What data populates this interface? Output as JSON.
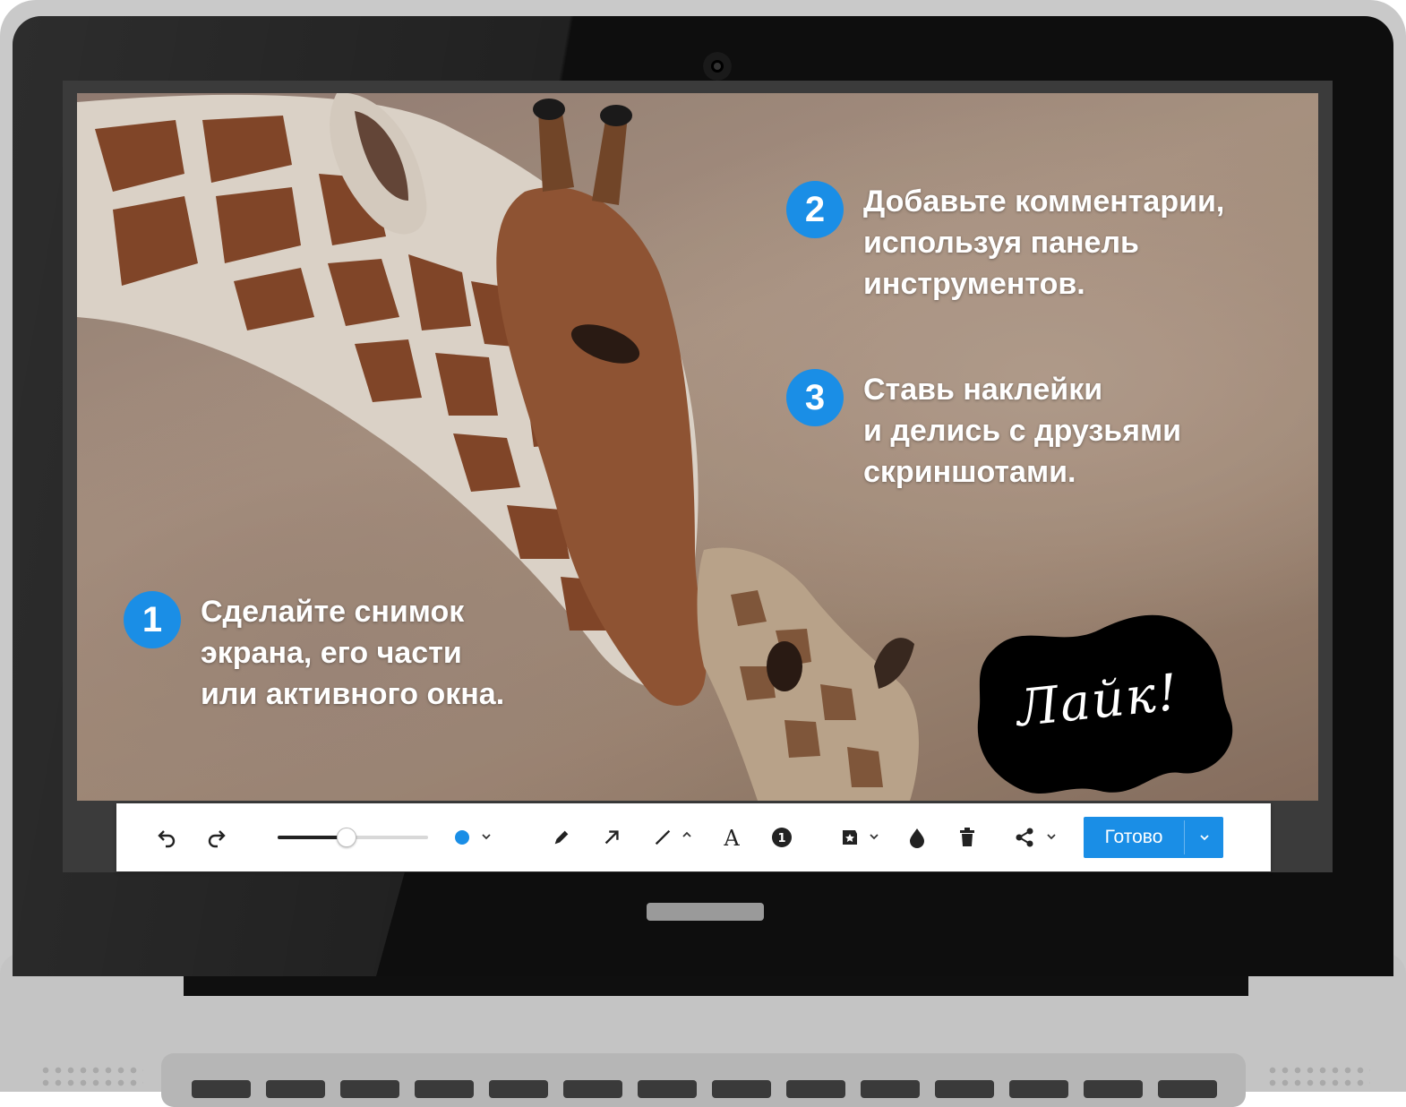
{
  "steps": [
    {
      "number": "1",
      "lines": [
        "Сделайте снимок",
        "экрана, его части",
        "или активного окна."
      ]
    },
    {
      "number": "2",
      "lines": [
        "Добавьте комментарии,",
        "используя панель",
        "инструментов."
      ]
    },
    {
      "number": "3",
      "lines": [
        "Ставь наклейки",
        "и делись с друзьями",
        "скриншотами."
      ]
    }
  ],
  "sticker": {
    "label": "Лайк!"
  },
  "toolbar": {
    "done_label": "Готово",
    "brush_size": 0.45,
    "selected_color": "#1a8ee6",
    "icons": [
      "undo-icon",
      "redo-icon",
      "pencil-icon",
      "arrow-icon",
      "line-icon",
      "text-icon",
      "number-marker-icon",
      "sticker-icon",
      "blur-drop-icon",
      "trash-icon",
      "share-icon"
    ]
  },
  "colors": {
    "accent": "#1a8ee6",
    "toolbar_bg": "#ffffff",
    "bezel": "#0e0e0e"
  }
}
